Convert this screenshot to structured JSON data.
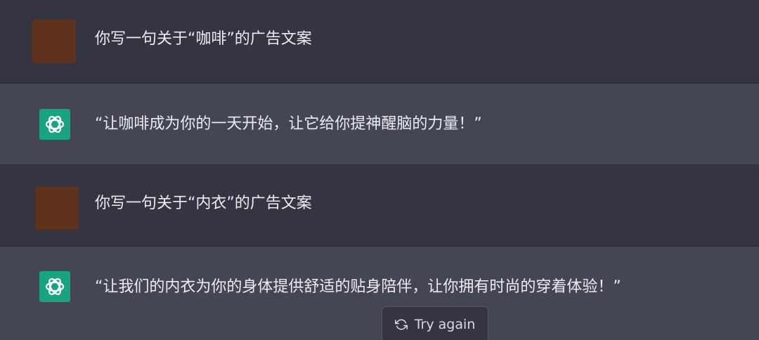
{
  "messages": [
    {
      "role": "user",
      "text": "你写一句关于“咖啡”的广告文案"
    },
    {
      "role": "assistant",
      "text": "“让咖啡成为你的一天开始，让它给你提神醒脑的力量！”"
    },
    {
      "role": "user",
      "text": "你写一句关于“内衣”的广告文案"
    },
    {
      "role": "assistant",
      "text": "“让我们的内衣为你的身体提供舒适的贴身陪伴，让你拥有时尚的穿着体验！”"
    }
  ],
  "controls": {
    "try_again_label": "Try again",
    "try_again_icon": "refresh-icon"
  },
  "colors": {
    "user_row_bg": "#343541",
    "assistant_row_bg": "#444654",
    "user_avatar": "#5e321c",
    "assistant_avatar": "#19a37f",
    "text": "#ececf1"
  },
  "icons": {
    "assistant_avatar": "openai-logo-icon"
  }
}
